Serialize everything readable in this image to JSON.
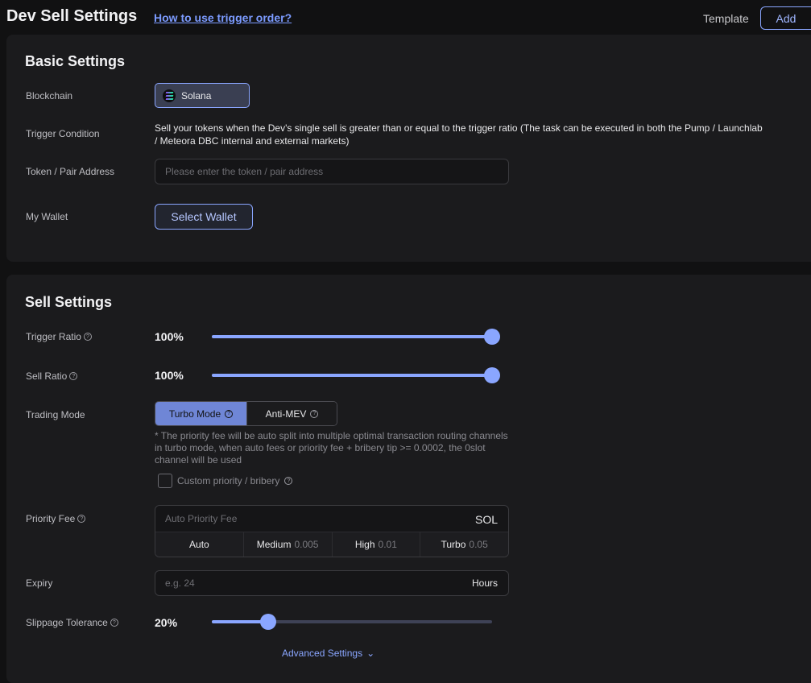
{
  "header": {
    "title": "Dev Sell Settings",
    "help_link": "How to use trigger order?",
    "template_label": "Template",
    "add_label": "Add"
  },
  "basic": {
    "title": "Basic Settings",
    "blockchain_label": "Blockchain",
    "blockchain_value": "Solana",
    "trigger_label": "Trigger Condition",
    "trigger_text": "Sell your tokens when the Dev's single sell is greater than or equal to the trigger ratio (The task can be executed in both the Pump / Launchlab / Meteora DBC internal and external markets)",
    "token_label": "Token / Pair Address",
    "token_placeholder": "Please enter the token / pair address",
    "token_value": "",
    "wallet_label": "My Wallet",
    "wallet_button": "Select Wallet"
  },
  "sell": {
    "title": "Sell Settings",
    "trigger_ratio_label": "Trigger Ratio",
    "trigger_ratio_value": "100%",
    "trigger_ratio_fraction": 1.0,
    "sell_ratio_label": "Sell Ratio",
    "sell_ratio_value": "100%",
    "sell_ratio_fraction": 1.0,
    "trading_mode_label": "Trading Mode",
    "modes": [
      "Turbo Mode",
      "Anti-MEV"
    ],
    "selected_mode": "Turbo Mode",
    "note": "* The priority fee will be auto split into multiple optimal transaction routing channels in turbo mode, when auto fees or priority fee + bribery tip >= 0.0002, the 0slot channel will be used",
    "custom_label": "Custom priority / bribery",
    "custom_checked": false,
    "priority_fee_label": "Priority Fee",
    "priority_fee_placeholder": "Auto Priority Fee",
    "priority_fee_unit": "SOL",
    "fee_options": [
      {
        "label": "Auto",
        "value": ""
      },
      {
        "label": "Medium",
        "value": "0.005"
      },
      {
        "label": "High",
        "value": "0.01"
      },
      {
        "label": "Turbo",
        "value": "0.05"
      }
    ],
    "expiry_label": "Expiry",
    "expiry_placeholder": "e.g. 24",
    "expiry_unit": "Hours",
    "slippage_label": "Slippage Tolerance",
    "slippage_value": "20%",
    "slippage_fraction": 0.2,
    "advanced_label": "Advanced Settings"
  },
  "colors": {
    "accent": "#8aa6ff",
    "panel": "#1b1b1d",
    "background": "#111112"
  }
}
